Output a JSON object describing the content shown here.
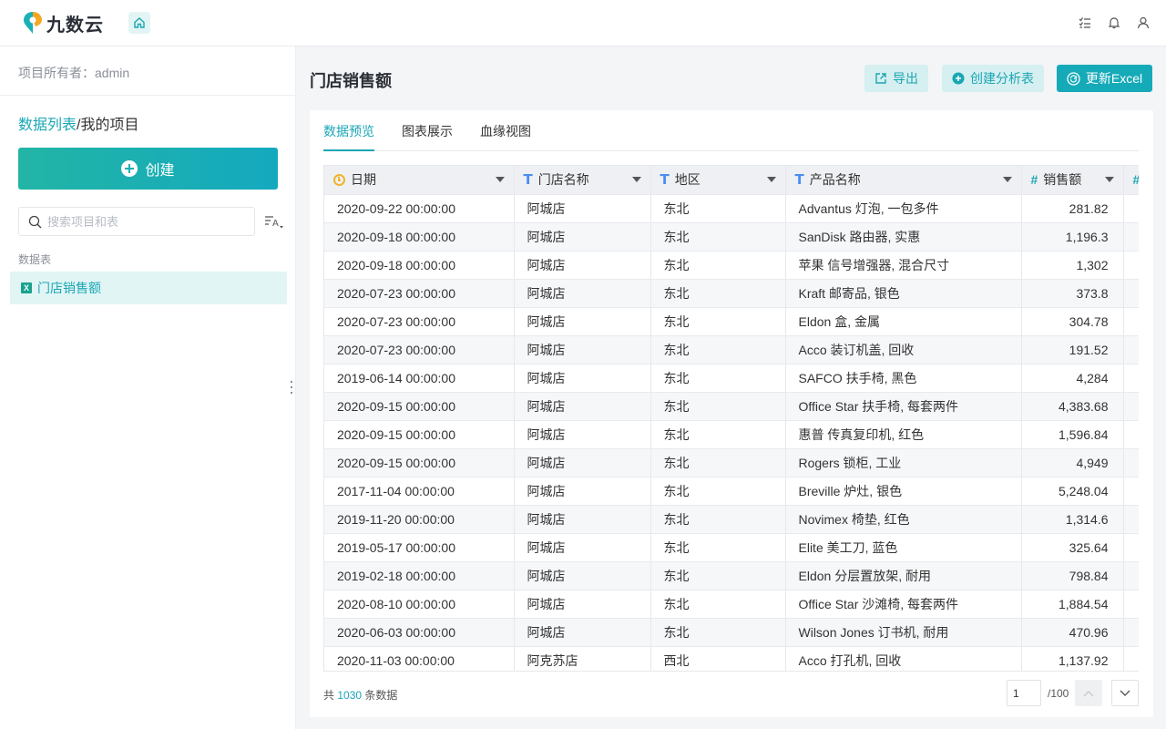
{
  "app": {
    "name": "九数云"
  },
  "sidebar": {
    "owner": "项目所有者：admin",
    "breadcrumb": {
      "link": "数据列表",
      "separator": "/",
      "current": "我的项目"
    },
    "create_label": "创建",
    "search_placeholder": "搜索项目和表",
    "section_label": "数据表",
    "items": [
      {
        "label": "门店销售额",
        "icon": "excel-icon"
      }
    ]
  },
  "main": {
    "title": "门店销售额",
    "buttons": {
      "export": "导出",
      "create_analysis": "创建分析表",
      "update_excel": "更新Excel"
    },
    "tabs": [
      {
        "label": "数据预览"
      },
      {
        "label": "图表展示"
      },
      {
        "label": "血缘视图"
      }
    ],
    "table": {
      "columns": [
        {
          "label": "日期",
          "type": "date"
        },
        {
          "label": "门店名称",
          "type": "text"
        },
        {
          "label": "地区",
          "type": "text"
        },
        {
          "label": "产品名称",
          "type": "text"
        },
        {
          "label": "销售额",
          "type": "number"
        }
      ],
      "rows": [
        [
          "2020-09-22 00:00:00",
          "阿城店",
          "东北",
          "Advantus 灯泡, 一包多件",
          "281.82"
        ],
        [
          "2020-09-18 00:00:00",
          "阿城店",
          "东北",
          "SanDisk 路由器, 实惠",
          "1,196.3"
        ],
        [
          "2020-09-18 00:00:00",
          "阿城店",
          "东北",
          "苹果 信号增强器, 混合尺寸",
          "1,302"
        ],
        [
          "2020-07-23 00:00:00",
          "阿城店",
          "东北",
          "Kraft 邮寄品, 银色",
          "373.8"
        ],
        [
          "2020-07-23 00:00:00",
          "阿城店",
          "东北",
          "Eldon 盒, 金属",
          "304.78"
        ],
        [
          "2020-07-23 00:00:00",
          "阿城店",
          "东北",
          "Acco 装订机盖, 回收",
          "191.52"
        ],
        [
          "2019-06-14 00:00:00",
          "阿城店",
          "东北",
          "SAFCO 扶手椅, 黑色",
          "4,284"
        ],
        [
          "2020-09-15 00:00:00",
          "阿城店",
          "东北",
          "Office Star 扶手椅, 每套两件",
          "4,383.68"
        ],
        [
          "2020-09-15 00:00:00",
          "阿城店",
          "东北",
          "惠普 传真复印机, 红色",
          "1,596.84"
        ],
        [
          "2020-09-15 00:00:00",
          "阿城店",
          "东北",
          "Rogers 锁柜, 工业",
          "4,949"
        ],
        [
          "2017-11-04 00:00:00",
          "阿城店",
          "东北",
          "Breville 炉灶, 银色",
          "5,248.04"
        ],
        [
          "2019-11-20 00:00:00",
          "阿城店",
          "东北",
          "Novimex 椅垫, 红色",
          "1,314.6"
        ],
        [
          "2019-05-17 00:00:00",
          "阿城店",
          "东北",
          "Elite 美工刀, 蓝色",
          "325.64"
        ],
        [
          "2019-02-18 00:00:00",
          "阿城店",
          "东北",
          "Eldon 分层置放架, 耐用",
          "798.84"
        ],
        [
          "2020-08-10 00:00:00",
          "阿城店",
          "东北",
          "Office Star 沙滩椅, 每套两件",
          "1,884.54"
        ],
        [
          "2020-06-03 00:00:00",
          "阿城店",
          "东北",
          "Wilson Jones 订书机, 耐用",
          "470.96"
        ],
        [
          "2020-11-03 00:00:00",
          "阿克苏店",
          "西北",
          "Acco 打孔机, 回收",
          "1,137.92"
        ]
      ]
    },
    "footer": {
      "prefix": "共",
      "count": "1030",
      "suffix": "条数据",
      "page": "1",
      "page_total": "/100"
    }
  },
  "colors": {
    "accent": "#1aa6b4",
    "date_icon": "#f0b429",
    "text_icon": "#4b8df0"
  }
}
